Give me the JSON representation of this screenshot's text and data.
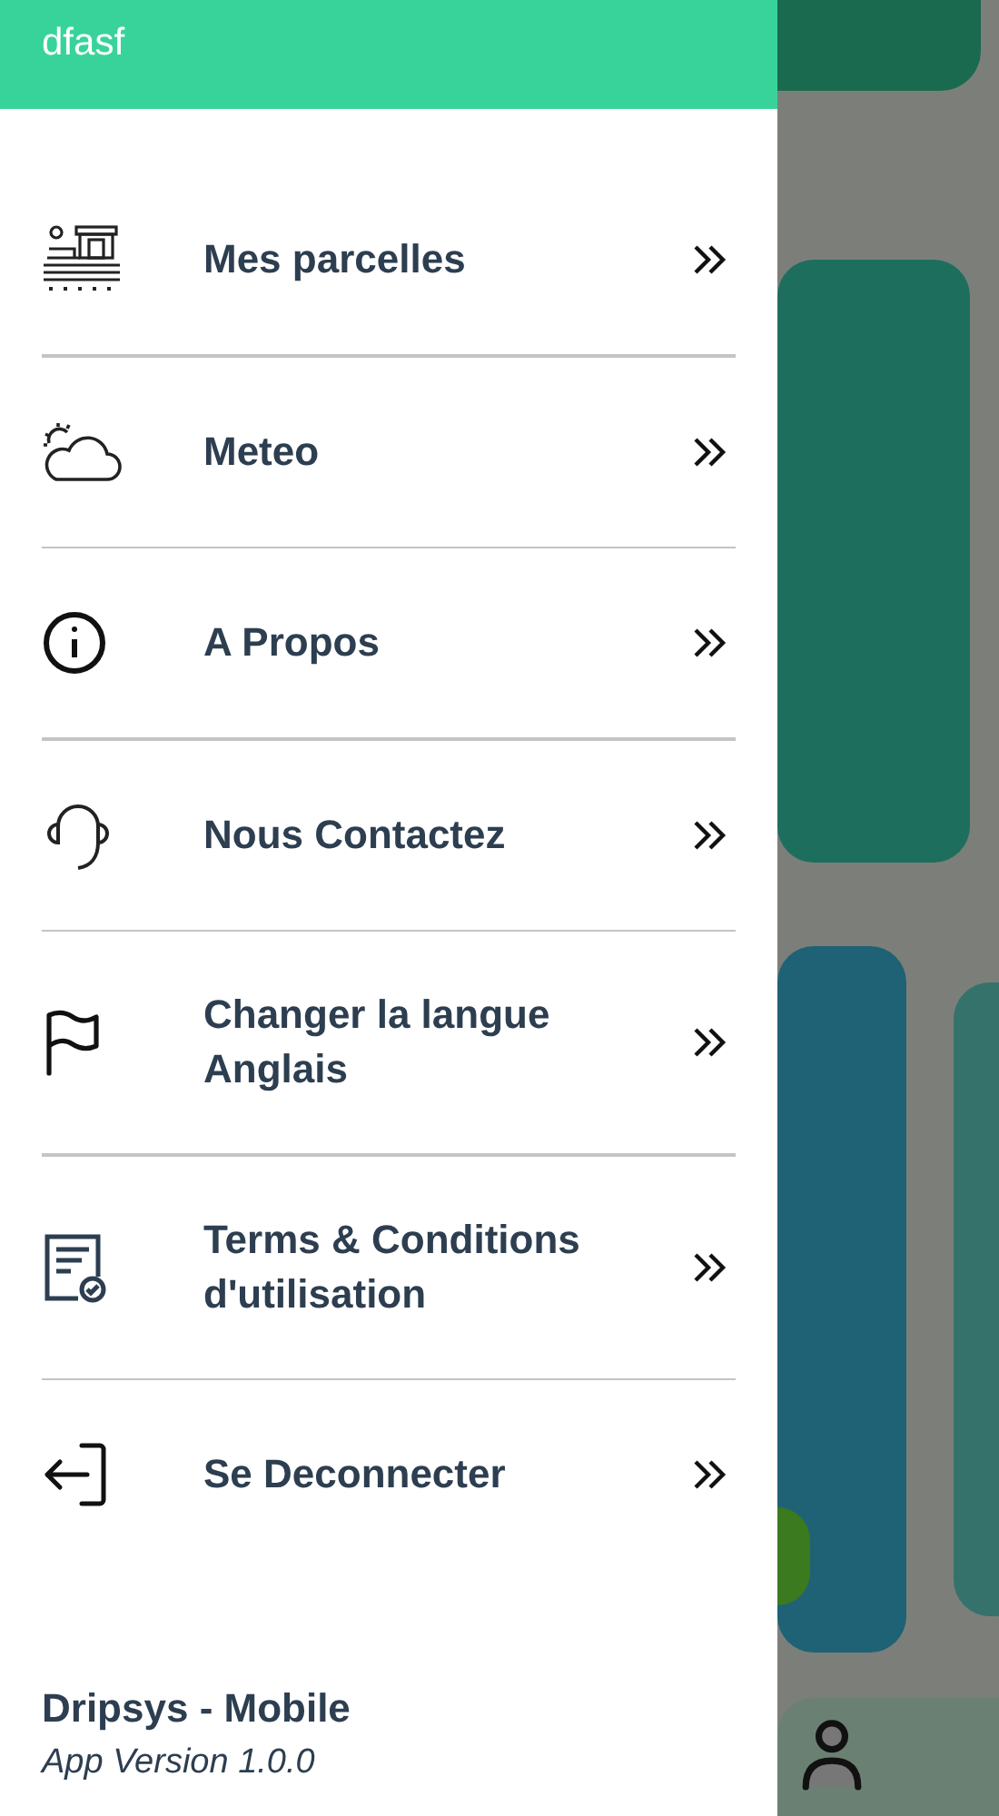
{
  "drawer": {
    "header": {
      "username": "dfasf"
    },
    "items": [
      {
        "kind": "parcels",
        "lines": [
          "Mes parcelles"
        ]
      },
      {
        "kind": "weather",
        "lines": [
          "Meteo"
        ]
      },
      {
        "kind": "info",
        "lines": [
          "A Propos"
        ]
      },
      {
        "kind": "contact",
        "lines": [
          "Nous Contactez"
        ]
      },
      {
        "kind": "language",
        "lines": [
          "Changer la langue",
          "Anglais"
        ]
      },
      {
        "kind": "terms",
        "lines": [
          "Terms & Conditions",
          "d'utilisation"
        ]
      },
      {
        "kind": "logout",
        "lines": [
          "Se Deconnecter"
        ]
      }
    ],
    "footer": {
      "app_name": "Dripsys - Mobile",
      "version": "App Version 1.0.0"
    }
  }
}
